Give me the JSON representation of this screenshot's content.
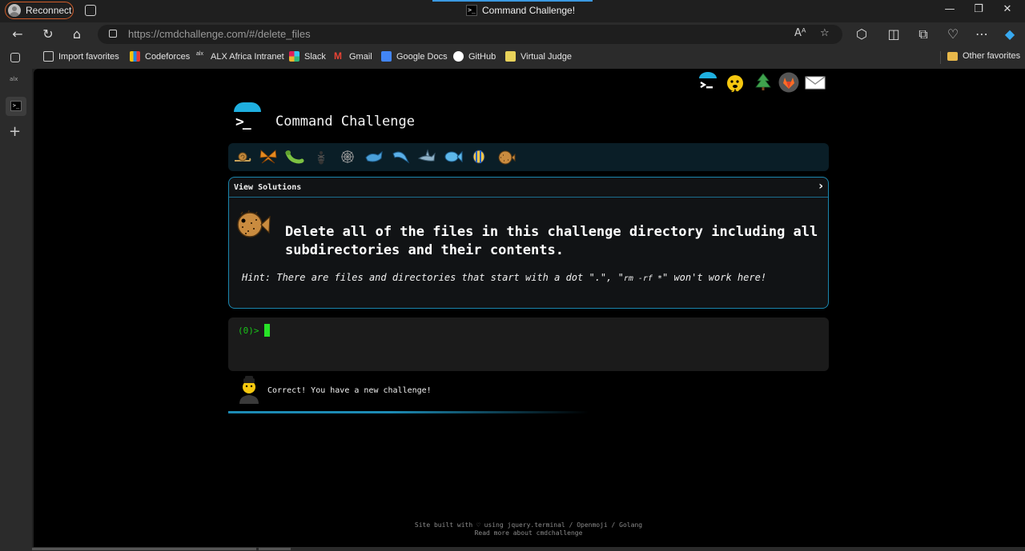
{
  "browser": {
    "reconnect_label": "Reconnect",
    "tab_title": "Command Challenge!",
    "url": "https://cmdchallenge.com/#/delete_files",
    "window_controls": [
      "—",
      "❐",
      "✕"
    ]
  },
  "bookmarks": [
    {
      "label": "Import favorites",
      "icon": "import-icon",
      "color": "#cfcfcf"
    },
    {
      "label": "Codeforces",
      "icon": "codeforces-icon",
      "color": "#f4c20d"
    },
    {
      "label": "ALX Africa Intranet",
      "icon": "alx-icon",
      "color": "#e0e0e0"
    },
    {
      "label": "Slack",
      "icon": "slack-icon",
      "color": "#e01e5a"
    },
    {
      "label": "Gmail",
      "icon": "gmail-icon",
      "color": "#ea4335"
    },
    {
      "label": "Google Docs",
      "icon": "docs-icon",
      "color": "#4285f4"
    },
    {
      "label": "GitHub",
      "icon": "github-icon",
      "color": "#ffffff"
    },
    {
      "label": "Virtual Judge",
      "icon": "vjudge-icon",
      "color": "#e8d25a"
    }
  ],
  "other_favorites": "Other favorites",
  "site": {
    "title": "Command Challenge",
    "view_solutions": "View Solutions",
    "challenge_text": "Delete all of the files in this challenge directory including all subdirectories and their contents.",
    "hint_before": "Hint: There are files and directories that start with a dot \".\", \"",
    "hint_code": "rm -rf *",
    "hint_after": "\" won't work here!",
    "prompt": "(0)>",
    "feedback": "Correct! You have a new challenge!",
    "footer_line1": "Site built with ♡ using jquery.terminal / Openmoji / Golang",
    "footer_line2": "Read more about cmdchallenge"
  },
  "colors": {
    "accent": "#1fb0e0",
    "panel_border": "#1b86ae",
    "prompt_green": "#19c419"
  }
}
